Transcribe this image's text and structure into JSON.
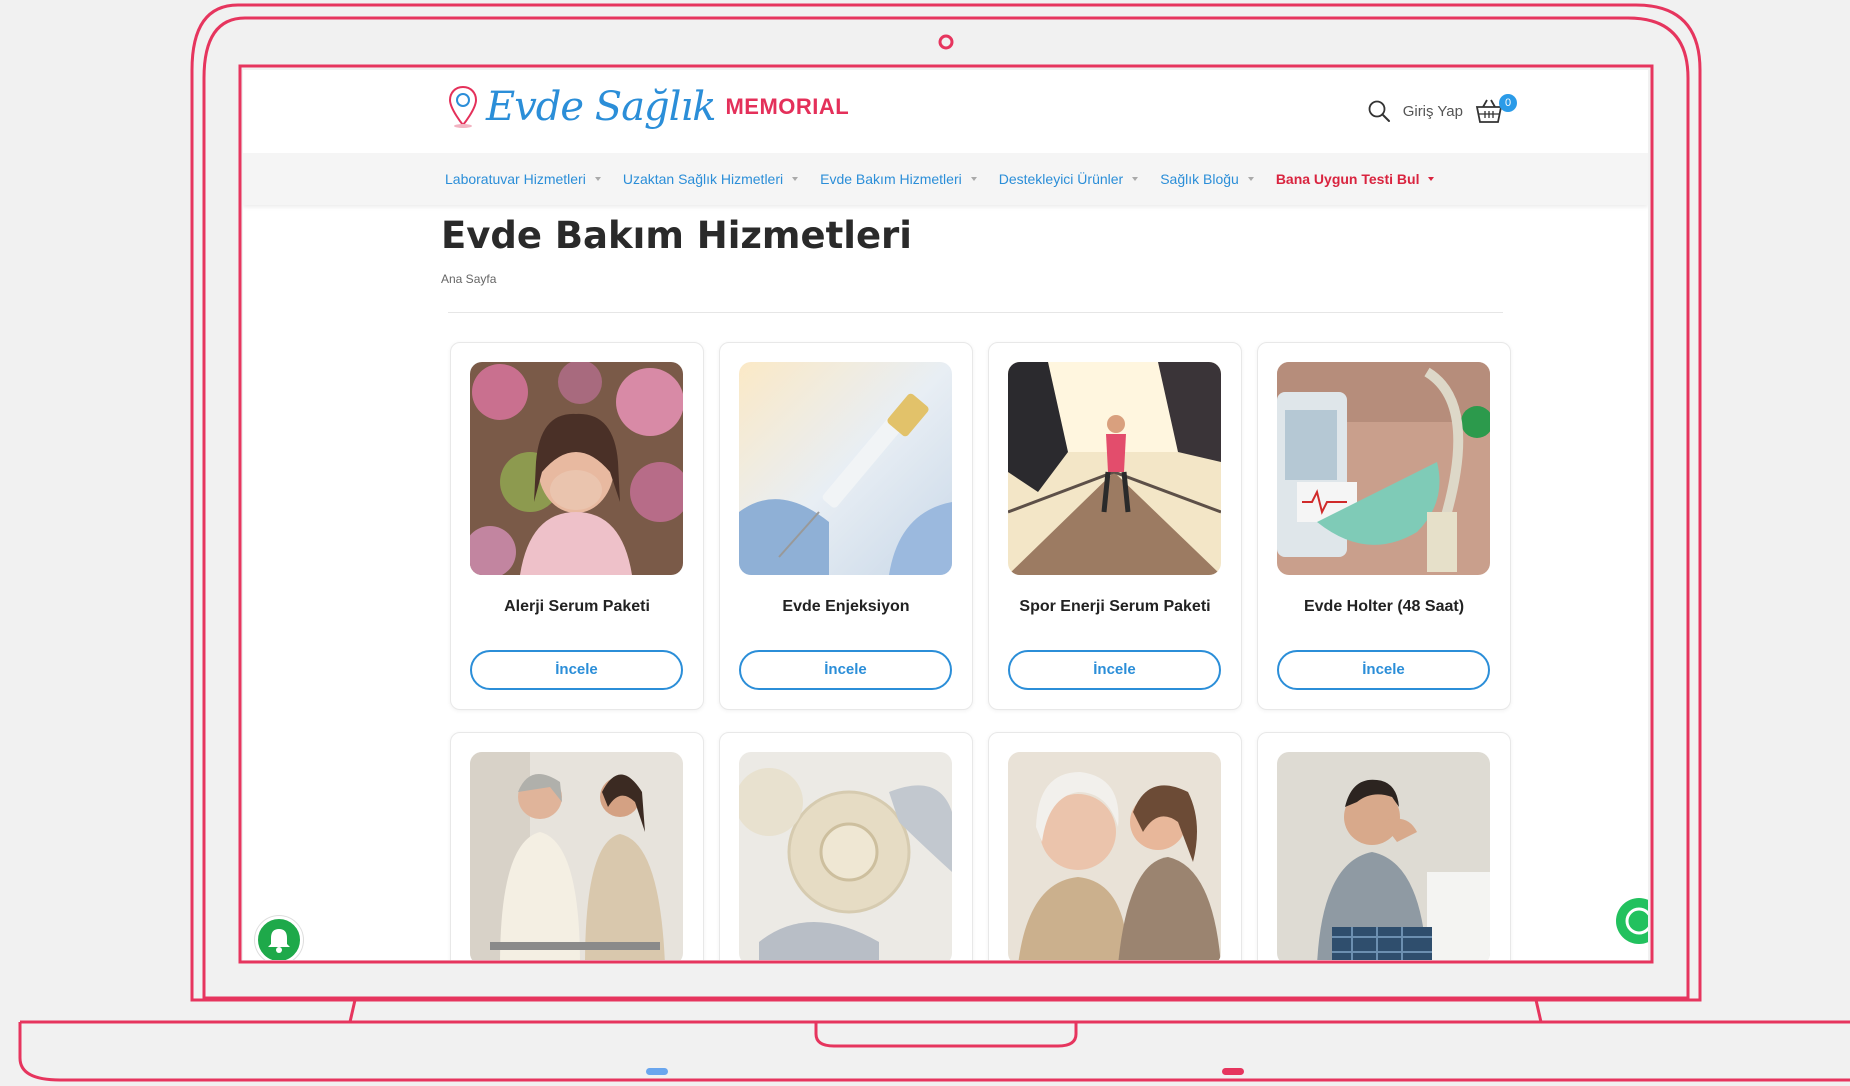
{
  "site": {
    "logo_script": "Evde Sağlık",
    "logo_brand": "MEMORIAL",
    "login_label": "Giriş Yap",
    "cart_count": "0"
  },
  "nav": {
    "items": [
      {
        "label": "Laboratuvar Hizmetleri"
      },
      {
        "label": "Uzaktan Sağlık Hizmetleri"
      },
      {
        "label": "Evde Bakım Hizmetleri"
      },
      {
        "label": "Destekleyici Ürünler"
      },
      {
        "label": "Sağlık Bloğu"
      },
      {
        "label": "Bana Uygun Testi Bul"
      }
    ]
  },
  "page": {
    "title": "Evde Bakım Hizmetleri",
    "breadcrumb": "Ana Sayfa"
  },
  "products": [
    {
      "name": "Alerji Serum Paketi",
      "button": "İncele"
    },
    {
      "name": "Evde Enjeksiyon",
      "button": "İncele"
    },
    {
      "name": "Spor Enerji Serum Paketi",
      "button": "İncele"
    },
    {
      "name": "Evde Holter (48 Saat)",
      "button": "İncele"
    }
  ],
  "colors": {
    "accent": "#2b8ed8",
    "frame": "#e6355e",
    "highlight_nav": "#d9243f"
  },
  "icons": {
    "search": "search-icon",
    "cart": "cart-icon",
    "bell": "bell-icon",
    "whatsapp": "whatsapp-icon"
  }
}
